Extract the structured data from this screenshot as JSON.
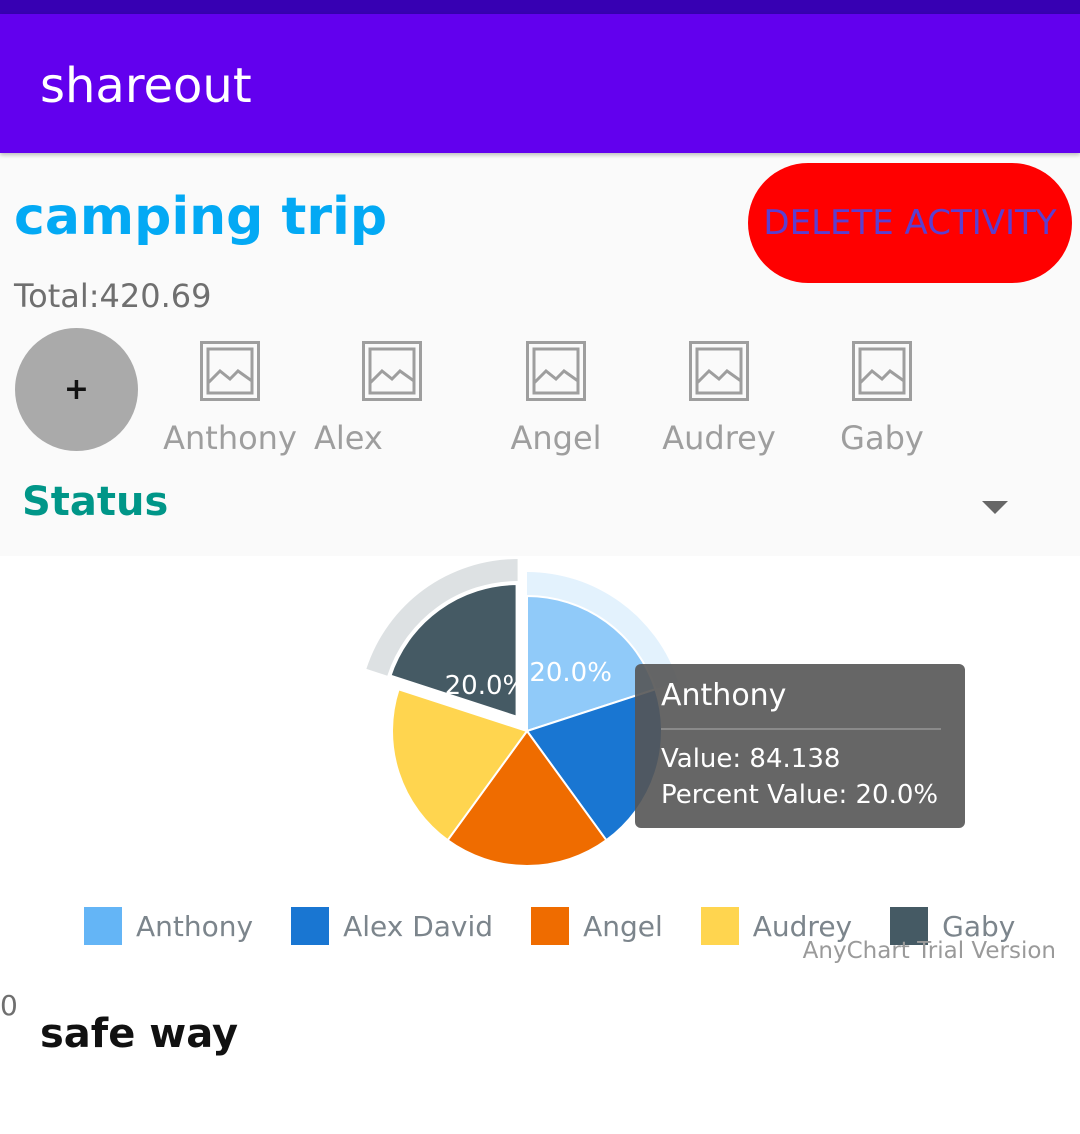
{
  "app": {
    "title": "shareout"
  },
  "activity": {
    "title": "camping trip",
    "delete_label": "DELETE ACTIVITY",
    "total": "Total:420.69",
    "add_label": "+"
  },
  "members": [
    {
      "name": "Anthony"
    },
    {
      "name": "Alex"
    },
    {
      "name": "Angel"
    },
    {
      "name": "Audrey"
    },
    {
      "name": "Gaby"
    }
  ],
  "status": {
    "label": "Status"
  },
  "chart_data": {
    "type": "pie",
    "categories": [
      "Anthony",
      "Alex David",
      "Angel",
      "Audrey",
      "Gaby"
    ],
    "values": [
      20.0,
      20.0,
      20.0,
      20.0,
      20.0
    ],
    "colors": [
      "#90caf9",
      "#1976d2",
      "#ef6c00",
      "#ffd54f",
      "#455a64"
    ],
    "labels": [
      "20.0%",
      "",
      "",
      "",
      "20.0%"
    ],
    "legend_colors": [
      "#64b5f6",
      "#1976d2",
      "#ef6c00",
      "#ffd54f",
      "#455a64"
    ],
    "legend_position": "bottom",
    "exploded": [
      "Gaby"
    ],
    "hovered": "Anthony"
  },
  "tooltip": {
    "title": "Anthony",
    "value_line": "Value: 84.138",
    "percent_line": "Percent Value: 20.0%"
  },
  "watermark": "AnyChart Trial Version",
  "expenses": {
    "amount": "0",
    "first_name": "safe way"
  }
}
